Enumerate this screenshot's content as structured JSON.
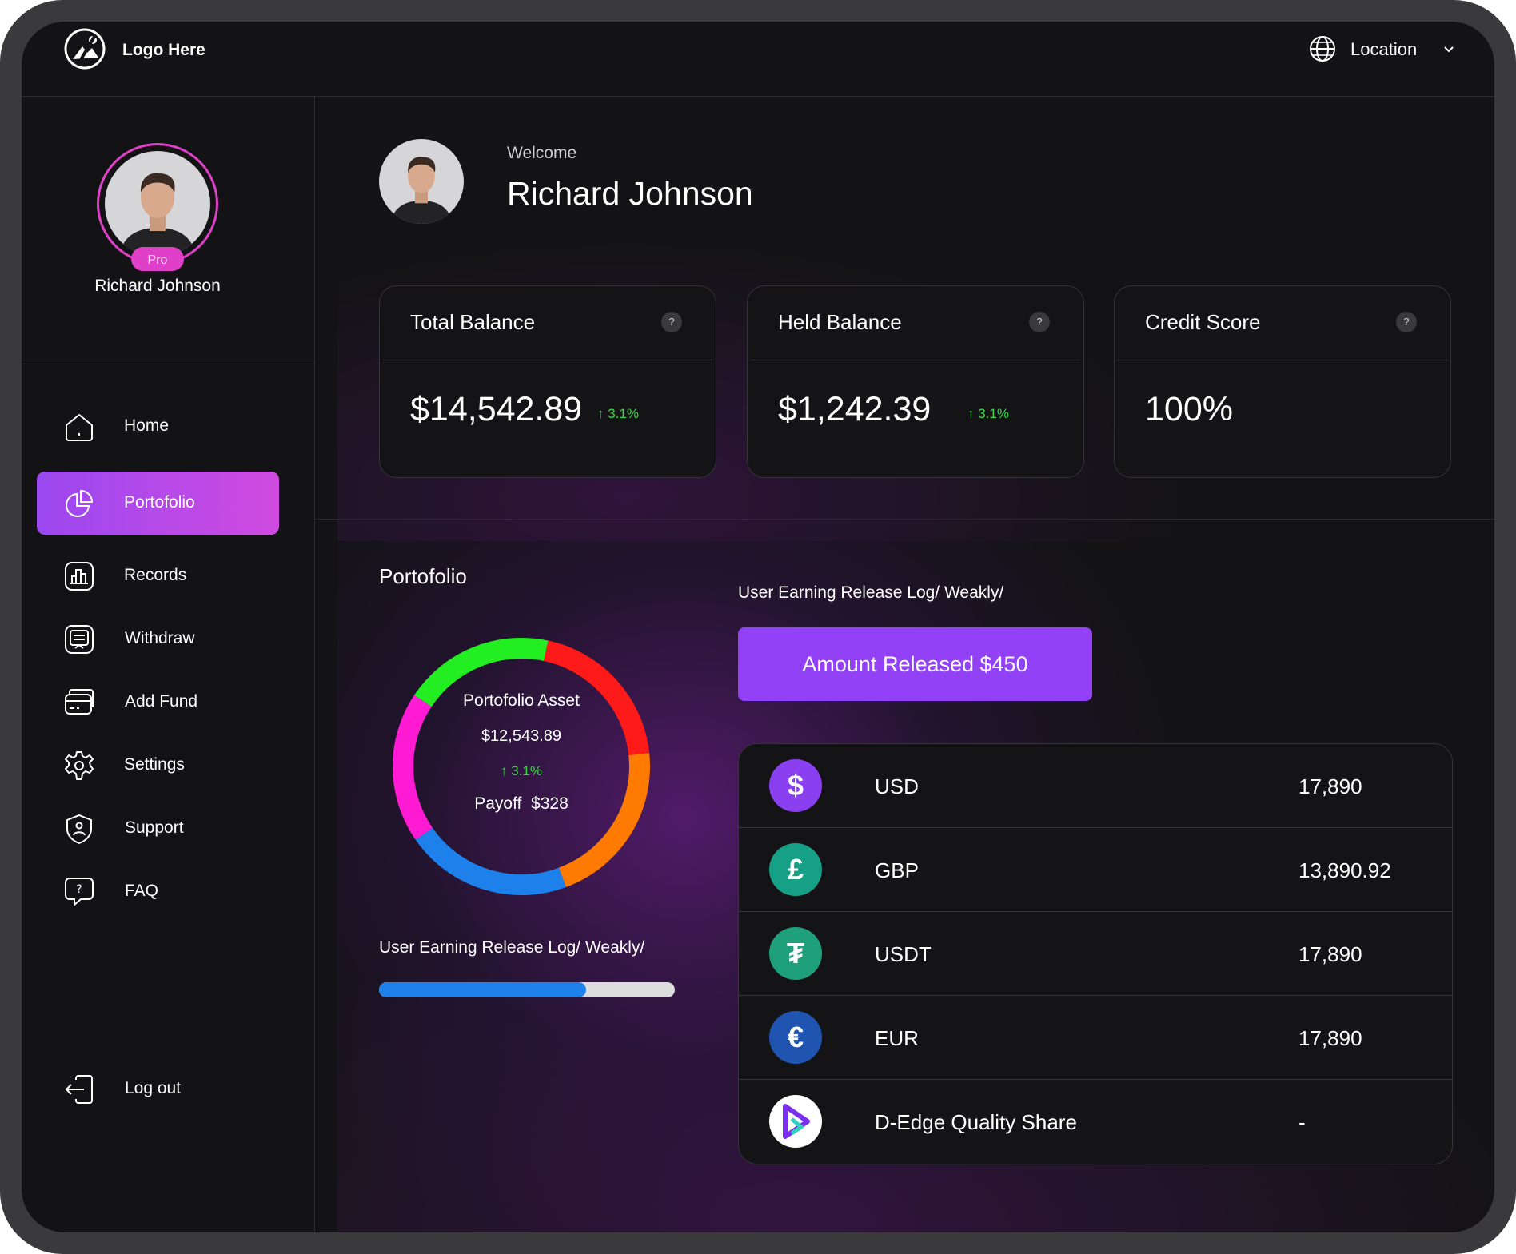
{
  "header": {
    "logo_text": "Logo Here",
    "location_label": "Location"
  },
  "sidebar": {
    "profile_name": "Richard Johnson",
    "badge": "Pro",
    "items": [
      {
        "label": "Home",
        "icon": "home-icon"
      },
      {
        "label": "Portofolio",
        "icon": "pie-chart-icon",
        "active": true
      },
      {
        "label": "Records",
        "icon": "bar-chart-icon"
      },
      {
        "label": "Withdraw",
        "icon": "withdraw-icon"
      },
      {
        "label": "Add Fund",
        "icon": "card-icon"
      },
      {
        "label": "Settings",
        "icon": "gear-icon"
      },
      {
        "label": "Support",
        "icon": "shield-icon"
      },
      {
        "label": "FAQ",
        "icon": "question-chat-icon"
      }
    ],
    "logout_label": "Log out"
  },
  "welcome": {
    "greeting": "Welcome",
    "name": "Richard Johnson"
  },
  "cards": [
    {
      "title": "Total Balance",
      "value": "$14,542.89",
      "change": "3.1%",
      "help": "?"
    },
    {
      "title": "Held Balance",
      "value": "$1,242.39",
      "change": "3.1%",
      "help": "?"
    },
    {
      "title": "Credit Score",
      "value": "100%",
      "help": "?"
    }
  ],
  "portfolio": {
    "title": "Portofolio",
    "asset_label": "Portofolio Asset",
    "asset_value": "$12,543.89",
    "change": "3.1%",
    "payoff": "Payoff  $328",
    "segments": [
      {
        "color": "#ff1a1a",
        "fraction": 0.2
      },
      {
        "color": "#ff7a00",
        "fraction": 0.21
      },
      {
        "color": "#1e80ea",
        "fraction": 0.21
      },
      {
        "color": "#ff1ad4",
        "fraction": 0.19
      },
      {
        "color": "#22ee22",
        "fraction": 0.19
      }
    ],
    "release_label": "User Earning Release Log/ Weakly/",
    "release_progress": 0.7
  },
  "earnings": {
    "release_label": "User Earning Release Log/ Weakly/",
    "button_label": "Amount Released $450",
    "rows": [
      {
        "name": "USD",
        "value": "17,890",
        "symbol": "$",
        "icon": "dollar-icon",
        "color": "#8a3ff0"
      },
      {
        "name": "GBP",
        "value": "13,890.92",
        "symbol": "£",
        "icon": "pound-icon",
        "color": "#16a085"
      },
      {
        "name": "USDT",
        "value": "17,890",
        "symbol": "₮",
        "icon": "tether-icon",
        "color": "#1ea07a"
      },
      {
        "name": "EUR",
        "value": "17,890",
        "symbol": "€",
        "icon": "euro-icon",
        "color": "#1f55b0"
      },
      {
        "name": "D-Edge Quality Share",
        "value": "-",
        "symbol": "",
        "icon": "d-edge-logo-icon",
        "color": "#ffffff"
      }
    ]
  }
}
